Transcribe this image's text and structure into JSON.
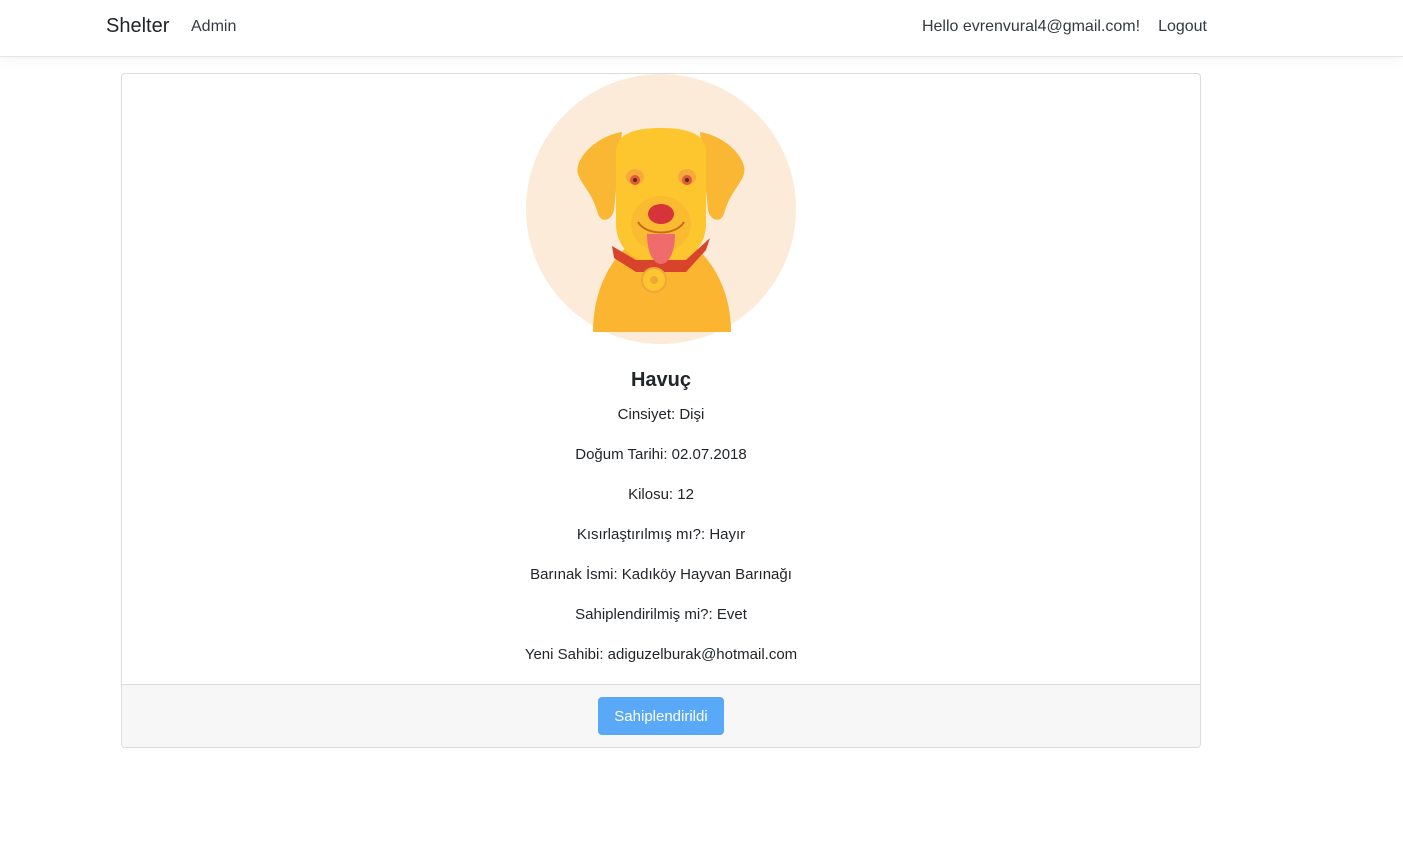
{
  "navbar": {
    "brand": "Shelter",
    "admin_link": "Admin",
    "greeting": "Hello evrenvural4@gmail.com!",
    "logout": "Logout"
  },
  "pet": {
    "name": "Havuç",
    "image_icon": "dog-illustration",
    "details": [
      "Cinsiyet: Dişi",
      "Doğum Tarihi: 02.07.2018",
      "Kilosu: 12",
      "Kısırlaştırılmış mı?: Hayır",
      "Barınak İsmi: Kadıköy Hayvan Barınağı",
      "Sahiplendirilmiş mi?: Evet",
      "Yeni Sahibi: adiguzelburak@hotmail.com"
    ]
  },
  "footer": {
    "button_label": "Sahiplendirildi"
  },
  "colors": {
    "avatar_bg": "#fdebd9",
    "dog_body": "#fbb531",
    "button": "#59a9f8"
  }
}
